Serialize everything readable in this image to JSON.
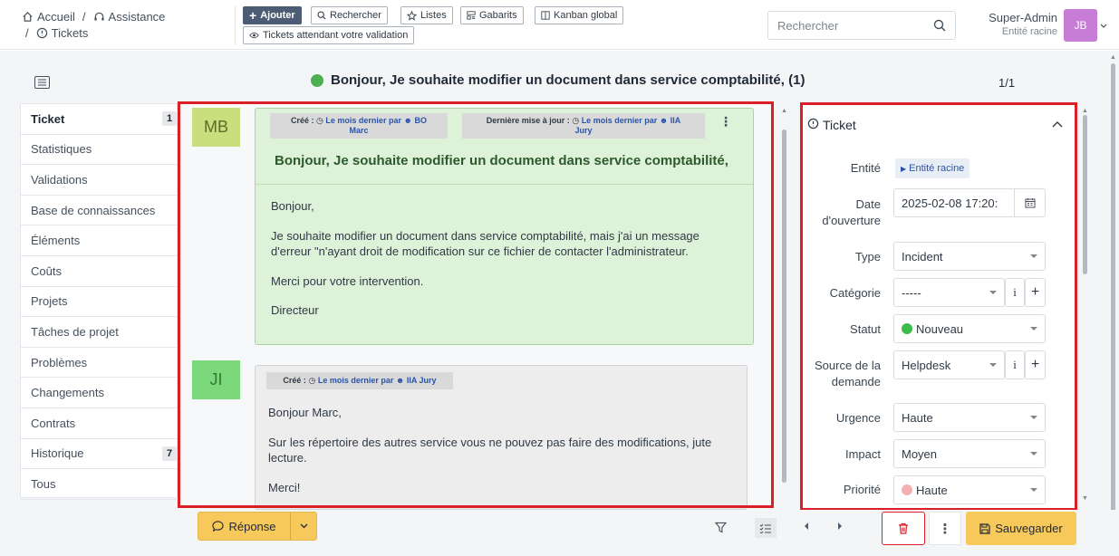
{
  "breadcrumb": {
    "home": "Accueil",
    "sep1": "/",
    "assistance": "Assistance",
    "sep2": "/",
    "tickets": "Tickets"
  },
  "toolbar": {
    "add": "Ajouter",
    "search": "Rechercher",
    "lists": "Listes",
    "templates": "Gabarits",
    "kanban": "Kanban global",
    "validation": "Tickets attendant votre validation"
  },
  "header_search": {
    "placeholder": "Rechercher"
  },
  "user": {
    "name": "Super-Admin",
    "entity": "Entité racine",
    "initials": "JB",
    "avatar_color": "#c77dd6"
  },
  "ticket": {
    "title": "Bonjour,  Je souhaite modifier un document dans service comptabilité, (1)",
    "status_color": "#4caf50",
    "pagination": "1/1"
  },
  "sidebar": {
    "items": [
      {
        "label": "Ticket",
        "badge": "1"
      },
      {
        "label": "Statistiques",
        "badge": ""
      },
      {
        "label": "Validations",
        "badge": ""
      },
      {
        "label": "Base de connaissances",
        "badge": ""
      },
      {
        "label": "Éléments",
        "badge": ""
      },
      {
        "label": "Coûts",
        "badge": ""
      },
      {
        "label": "Projets",
        "badge": ""
      },
      {
        "label": "Tâches de projet",
        "badge": ""
      },
      {
        "label": "Problèmes",
        "badge": ""
      },
      {
        "label": "Changements",
        "badge": ""
      },
      {
        "label": "Contrats",
        "badge": ""
      },
      {
        "label": "Historique",
        "badge": "7"
      },
      {
        "label": "Tous",
        "badge": ""
      }
    ]
  },
  "messages": [
    {
      "initials": "MB",
      "avatar_color": "#c9de7c",
      "created_label": "Créé :",
      "created_when": "Le mois dernier par",
      "created_by_1": "BO",
      "created_by_2": "Marc",
      "updated_label": "Dernière mise à jour :",
      "updated_when": "Le mois dernier par",
      "updated_by_1": "IIA",
      "updated_by_2": "Jury",
      "subject": "Bonjour,  Je souhaite modifier un document dans service comptabilité,",
      "p1": "Bonjour,",
      "p2a": "Je souhaite modifier un document dans service comptabilité, mais j'ai un message",
      "p2b": "d'erreur \"n'ayant droit de modification sur ce fichier de contacter l'administrateur.",
      "p3": "Merci pour votre intervention.",
      "p4": "Directeur"
    },
    {
      "initials": "JI",
      "avatar_color": "#7bd97b",
      "created_label": "Créé :",
      "created_when": "Le mois dernier par",
      "created_by": "IIA Jury",
      "p1": "Bonjour Marc,",
      "p2a": "Sur les répertoire des autres service vous ne pouvez pas faire des modifications, jute",
      "p2b": "lecture.",
      "p3": "Merci!"
    }
  ],
  "panel": {
    "title": "Ticket",
    "fields": {
      "entity_label": "Entité",
      "entity_value": "Entité racine",
      "date_label_1": "Date",
      "date_label_2": "d'ouverture",
      "date_value": "2025-02-08 17:20:",
      "type_label": "Type",
      "type_value": "Incident",
      "category_label": "Catégorie",
      "category_value": "-----",
      "status_label": "Statut",
      "status_value": "Nouveau",
      "status_color": "#3dbb4b",
      "source_label_1": "Source de la",
      "source_label_2": "demande",
      "source_value": "Helpdesk",
      "urgency_label": "Urgence",
      "urgency_value": "Haute",
      "impact_label": "Impact",
      "impact_value": "Moyen",
      "priority_label": "Priorité",
      "priority_value": "Haute",
      "priority_color": "#f4b0b0"
    }
  },
  "footer": {
    "reply": "Réponse",
    "save": "Sauvegarder"
  }
}
